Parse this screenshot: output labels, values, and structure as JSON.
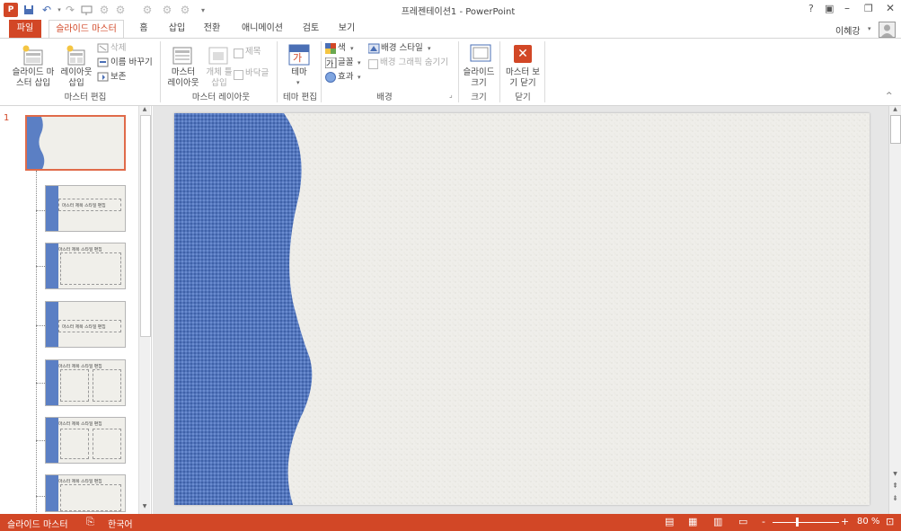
{
  "window": {
    "title": "프레젠테이션1 - PowerPoint",
    "user": "이혜강",
    "help": "?",
    "accent": "#d24726"
  },
  "quick_access": {
    "app_icon": "powerpoint-icon",
    "icons": [
      "save-icon",
      "undo-icon",
      "redo-icon",
      "start-from-beginning-icon",
      "touch-mode-icon",
      "quick-access-icon",
      "quick-access-icon",
      "quick-access-icon",
      "customize-icon"
    ]
  },
  "tabs": {
    "file": "파일",
    "slide_master": "슬라이드 마스터",
    "home": "홈",
    "insert": "삽입",
    "transitions": "전환",
    "animations": "애니메이션",
    "review": "검토",
    "view": "보기"
  },
  "ribbon": {
    "insert_slide_master": "슬라이드 마\n스터 삽입",
    "insert_layout": "레이아웃\n삽입",
    "delete": "삭제",
    "rename": "이름 바꾸기",
    "preserve": "보존",
    "master_layout": "마스터\n레이아웃",
    "insert_placeholder": "개체 틀\n삽입",
    "title_check": "제목",
    "footer_check": "바닥글",
    "themes": "테마",
    "colors": "색",
    "fonts": "글꼴",
    "effects": "효과",
    "background_styles": "배경 스타일",
    "hide_bg_graphics": "배경 그래픽 숨기기",
    "slide_size": "슬라이드\n크기",
    "close_master": "마스터 보\n기 닫기",
    "groups": {
      "edit_master": "마스터 편집",
      "master_layout": "마스터 레이아웃",
      "edit_theme": "테마 편집",
      "background": "배경",
      "size": "크기",
      "close": "닫기"
    }
  },
  "thumbnails": {
    "master_number": "1",
    "captions": [
      "마스터 제목 스타일 편집",
      "마스터 제목 스타일 편집",
      "마스터 제목 스타일 편집",
      "마스터 제목 스타일 편집",
      "마스터 제목 스타일 편집",
      "마스터 제목 스타일 편집"
    ]
  },
  "status": {
    "view_name": "슬라이드 마스터",
    "language": "한국어",
    "zoom": "80 %",
    "zoom_minus": "-",
    "zoom_plus": "+"
  },
  "colors": {
    "blue_pattern": "#5b7fc4",
    "slide_bg": "#efeeea",
    "status_bar": "#d24726"
  }
}
